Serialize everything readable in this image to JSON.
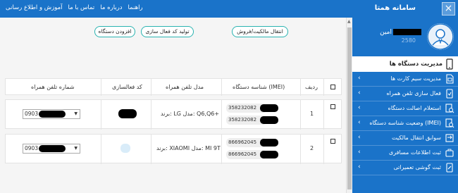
{
  "app": {
    "title": "سامانه همتا",
    "close_label": "×"
  },
  "topnav": {
    "items": [
      {
        "label": "راهنما"
      },
      {
        "label": "درباره ما"
      },
      {
        "label": "تماس با ما"
      },
      {
        "label": "آموزش و اطلاع رسانی"
      }
    ]
  },
  "user": {
    "name": "امین",
    "id_suffix": "2580"
  },
  "sidebar": {
    "active": {
      "label": "مدیریت دستگاه ها",
      "icon": "phone-icon"
    },
    "items": [
      {
        "label": "مدیریت سیم کارت ها",
        "icon": "sim-icon"
      },
      {
        "label": "فعال سازی تلفن همراه",
        "icon": "phone-check-icon"
      },
      {
        "label": "استعلام اصالت دستگاه",
        "icon": "search-doc-icon"
      },
      {
        "label": "وضعیت شناسه دستگاه (IMEI)",
        "icon": "search-doc-icon"
      },
      {
        "label": "سوابق انتقال مالکیت",
        "icon": "transfer-icon"
      },
      {
        "label": "ثبت اطلاعات مسافری",
        "icon": "suitcase-icon"
      },
      {
        "label": "ثبت گوشی تعمیراتی",
        "icon": "wrench-phone-icon"
      }
    ]
  },
  "actions": {
    "transfer": "انتقال مالکیت/فروش",
    "generate_code": "تولید کد فعال سازی",
    "add_device": "افزودن دستگاه"
  },
  "table": {
    "headers": {
      "row": "ردیف",
      "imei": "شناسه دستگاه (IMEI)",
      "model": "مدل تلفن همراه",
      "code": "کد فعالسازی",
      "phone": "شماره تلفن همراه"
    },
    "rows": [
      {
        "num": "1",
        "imei1": "358232082",
        "imei2": "358232082",
        "model": "برند: LG مدل: Q6,Q6+",
        "phone_prefix": "0903"
      },
      {
        "num": "2",
        "imei1": "866962045",
        "imei2": "866962045",
        "model": "برند: XIAOMI مدل: MI 9T",
        "phone_prefix": "0903"
      }
    ]
  }
}
